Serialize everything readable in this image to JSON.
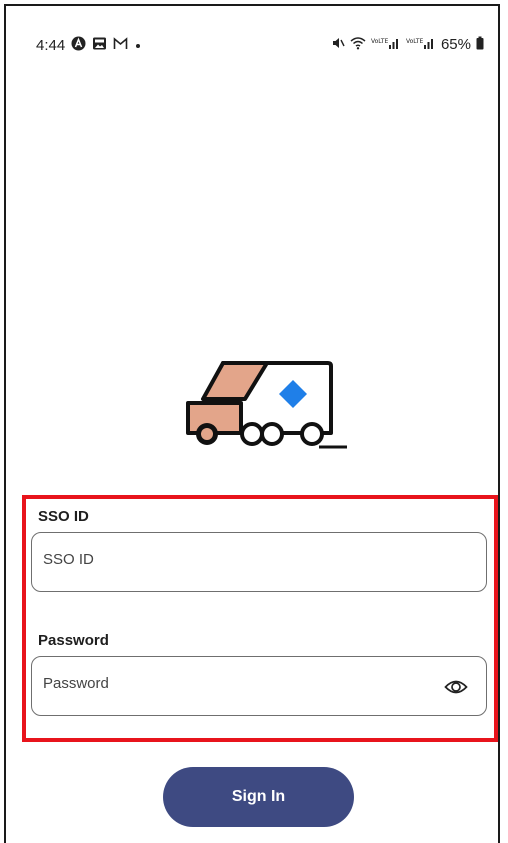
{
  "status_bar": {
    "time": "4:44",
    "battery": "65%",
    "left_icons": [
      "a-app-icon",
      "image-icon",
      "gmail-icon",
      "dot-icon"
    ],
    "right_icons": [
      "mute-icon",
      "wifi-icon",
      "signal-icon",
      "signal-icon",
      "battery-icon"
    ]
  },
  "logo": {
    "name": "delivery-van-icon",
    "colors": {
      "cab": "#e3a58a",
      "outline": "#111111",
      "diamond": "#1f7fe8"
    }
  },
  "form": {
    "sso": {
      "label": "SSO ID",
      "placeholder": "SSO ID"
    },
    "password": {
      "label": "Password",
      "placeholder": "Password"
    }
  },
  "signin": {
    "label": "Sign In"
  },
  "colors": {
    "accent": "#3e4a82",
    "highlight": "#e8141c"
  }
}
